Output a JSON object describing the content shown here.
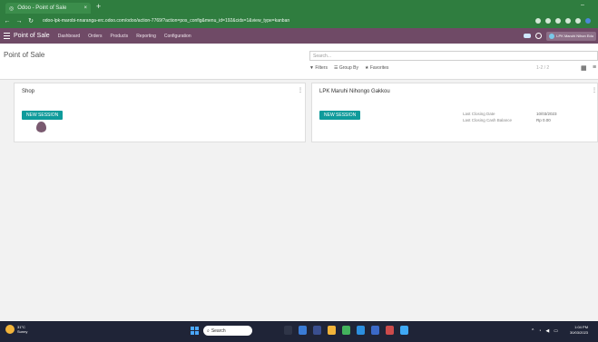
{
  "browser": {
    "tab_title": "Odoo - Point of Sale",
    "tab_close": "×",
    "new_tab": "+",
    "url": "odoo-lpk-marobi-nnaranga-erc.odoo.com/odoo/action-7769/?action=pos_config&menu_id=192&cids=1&view_type=kanban",
    "window_minimize": "–"
  },
  "odoo_nav": {
    "app_name": "Point of Sale",
    "menu": [
      "Dashboard",
      "Orders",
      "Products",
      "Reporting",
      "Configuration"
    ],
    "company": "LPK Maruhi Nihon Edu"
  },
  "control_panel": {
    "title": "Point of Sale",
    "search_placeholder": "Search...",
    "filters_label": "Filters",
    "group_by_label": "Group By",
    "favorites_label": "Favorites",
    "pager": "1-2 / 2"
  },
  "cards": [
    {
      "title": "Shop",
      "button": "NEW SESSION"
    },
    {
      "title": "LPK Maruhi Nihongo Gakkou",
      "button": "NEW SESSION",
      "last_closing_date_label": "Last Closing Date",
      "last_closing_date": "10/03/2023",
      "last_closing_balance_label": "Last Closing Cash Balance",
      "last_closing_balance": "Rp 0.00"
    }
  ],
  "taskbar": {
    "weather_temp": "31°C",
    "weather_text": "Sunny",
    "search_label": "Search",
    "time": "1:04 PM",
    "date": "30/03/2023"
  }
}
